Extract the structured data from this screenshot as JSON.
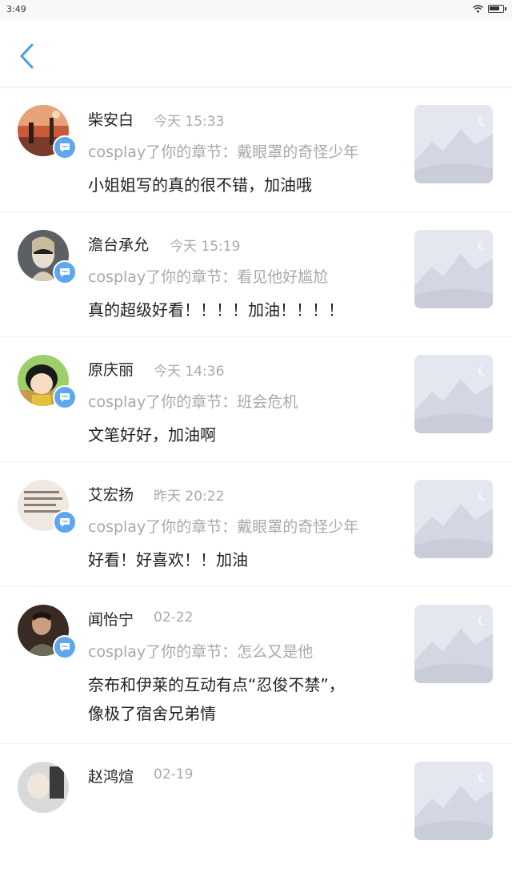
{
  "status_bar": {
    "time": "3:49"
  },
  "header": {
    "back_icon": "chevron-left-icon"
  },
  "colors": {
    "accent": "#5ea7ef",
    "name": "#222222",
    "meta": "#aaaaaa",
    "divider": "#efefef"
  },
  "items": [
    {
      "name": "柴安白",
      "time": "今天 15:33",
      "reply_ref": "cosplay了你的章节：戴眼罩的奇怪少年",
      "comment": "小姐姐写的真的很不错，加油哦"
    },
    {
      "name": "澹台承允",
      "time": "今天 15:19",
      "reply_ref": "cosplay了你的章节：看见他好尴尬",
      "comment": "真的超级好看！！！！加油！！！！"
    },
    {
      "name": "原庆丽",
      "time": "今天 14:36",
      "reply_ref": "cosplay了你的章节：班会危机",
      "comment": "文笔好好，加油啊"
    },
    {
      "name": "艾宏扬",
      "time": "昨天 20:22",
      "reply_ref": "cosplay了你的章节：戴眼罩的奇怪少年",
      "comment": "好看！好喜欢！！加油"
    },
    {
      "name": "闻怡宁",
      "time": "02-22",
      "reply_ref": "cosplay了你的章节：怎么又是他",
      "comment": "奈布和伊莱的互动有点“忍俊不禁”，像极了宿舍兄弟情"
    },
    {
      "name": "赵鸿煊",
      "time": "02-19",
      "reply_ref": "",
      "comment": ""
    }
  ]
}
